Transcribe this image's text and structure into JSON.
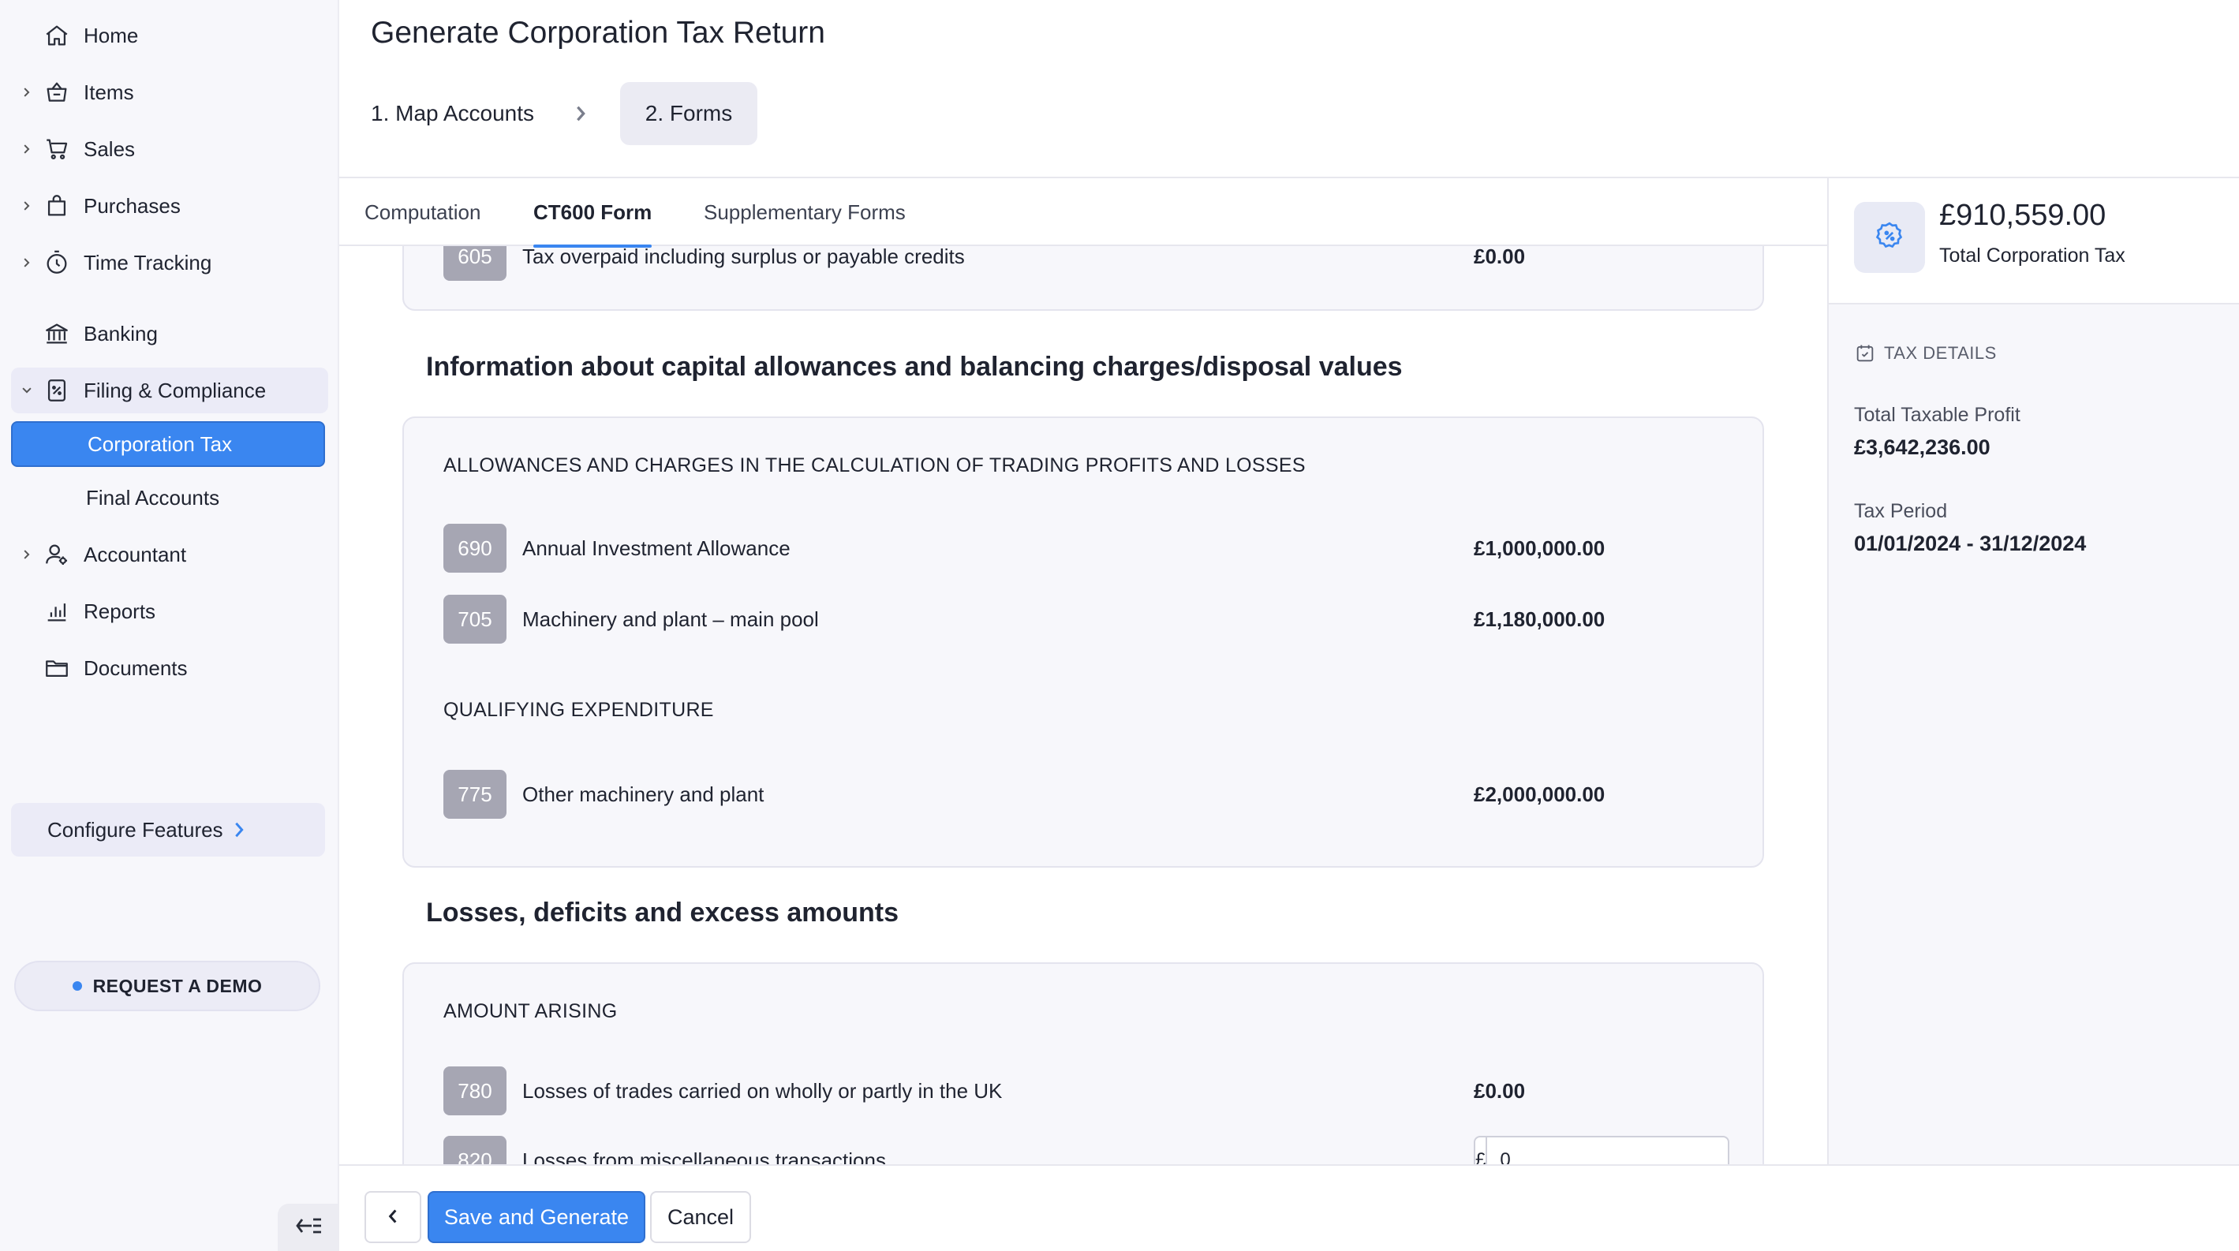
{
  "sidebar": {
    "items": [
      {
        "label": "Home",
        "icon": "home-icon",
        "has_chevron": false
      },
      {
        "label": "Items",
        "icon": "basket-icon",
        "has_chevron": true
      },
      {
        "label": "Sales",
        "icon": "cart-icon",
        "has_chevron": true
      },
      {
        "label": "Purchases",
        "icon": "shopping-bag-icon",
        "has_chevron": true
      },
      {
        "label": "Time Tracking",
        "icon": "stopwatch-icon",
        "has_chevron": true
      },
      {
        "label": "Banking",
        "icon": "bank-icon",
        "has_chevron": false
      },
      {
        "label": "Filing & Compliance",
        "icon": "tax-document-icon",
        "has_chevron": true,
        "expanded": true
      },
      {
        "label": "Accountant",
        "icon": "accountant-icon",
        "has_chevron": true
      },
      {
        "label": "Reports",
        "icon": "bar-chart-icon",
        "has_chevron": false
      },
      {
        "label": "Documents",
        "icon": "folder-icon",
        "has_chevron": false
      }
    ],
    "sub_items": [
      {
        "label": "Corporation Tax",
        "active": true
      },
      {
        "label": "Final Accounts",
        "active": false
      }
    ],
    "configure_label": "Configure Features",
    "demo_label": "REQUEST A DEMO"
  },
  "header": {
    "title": "Generate Corporation Tax Return",
    "steps": [
      {
        "label": "1. Map Accounts",
        "active": false
      },
      {
        "label": "2. Forms",
        "active": true
      }
    ]
  },
  "tabs": [
    {
      "label": "Computation",
      "active": false
    },
    {
      "label": "CT600 Form",
      "active": true
    },
    {
      "label": "Supplementary Forms",
      "active": false
    }
  ],
  "form": {
    "top_partial_row": {
      "code": "605",
      "description": "Tax overpaid including surplus or payable credits",
      "amount": "£0.00"
    },
    "capital_allowances": {
      "heading": "Information about capital allowances and balancing charges/disposal values",
      "groups": [
        {
          "title": "ALLOWANCES AND CHARGES IN THE CALCULATION OF TRADING PROFITS AND LOSSES",
          "rows": [
            {
              "code": "690",
              "description": "Annual Investment Allowance",
              "amount": "£1,000,000.00"
            },
            {
              "code": "705",
              "description": "Machinery and plant – main pool",
              "amount": "£1,180,000.00"
            }
          ]
        },
        {
          "title": "QUALIFYING EXPENDITURE",
          "rows": [
            {
              "code": "775",
              "description": "Other machinery and plant",
              "amount": "£2,000,000.00"
            }
          ]
        }
      ]
    },
    "losses": {
      "heading": "Losses, deficits and excess amounts",
      "group_title": "AMOUNT ARISING",
      "rows": [
        {
          "code": "780",
          "description": "Losses of trades carried on wholly or partly in the UK",
          "amount": "£0.00"
        },
        {
          "code": "820",
          "description": "Losses from miscellaneous transactions",
          "currency": "£",
          "input_value": "0"
        }
      ]
    }
  },
  "summary": {
    "total_tax_value": "£910,559.00",
    "total_tax_label": "Total Corporation Tax",
    "details_heading": "TAX DETAILS",
    "taxable_profit_label": "Total Taxable Profit",
    "taxable_profit_value": "£3,642,236.00",
    "tax_period_label": "Tax Period",
    "tax_period_value": "01/01/2024 - 31/12/2024"
  },
  "footer": {
    "back_icon": "chevron-left-icon",
    "save_label": "Save and Generate",
    "cancel_label": "Cancel"
  },
  "colors": {
    "accent": "#3a86f0",
    "sidebar_bg": "#f7f7fb",
    "code_badge": "#a6a6b3"
  }
}
